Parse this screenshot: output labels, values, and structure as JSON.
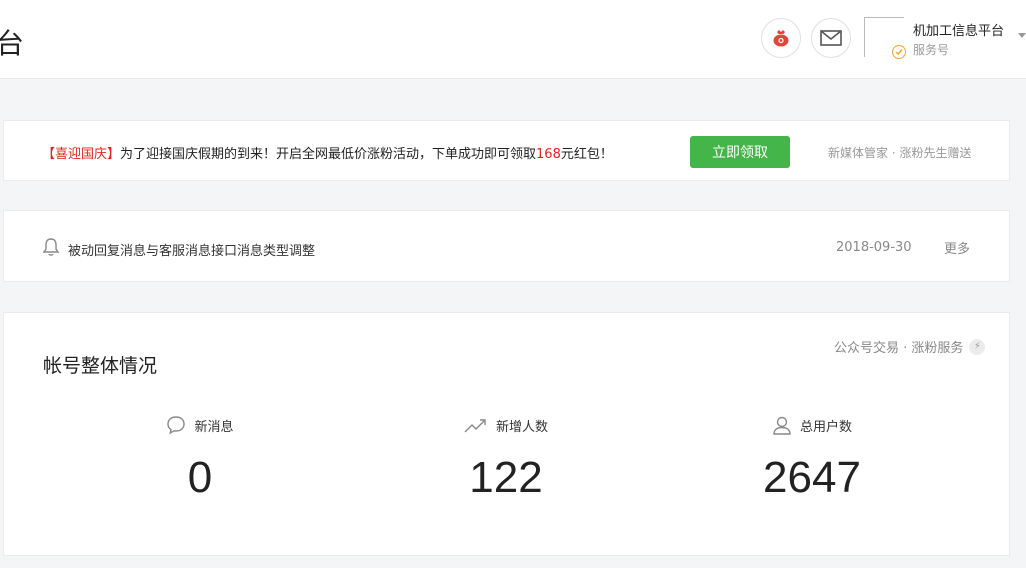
{
  "header": {
    "page_title": "台",
    "account_name": "机加工信息平台",
    "account_type": "服务号",
    "colors": {
      "bag": "#e2453a",
      "verified": "#f3a52c"
    },
    "icons": [
      "money-bag-icon",
      "mail-icon",
      "verified-badge-icon",
      "chevron-down-icon"
    ]
  },
  "promo": {
    "tag": "【喜迎国庆】",
    "text_before": "为了迎接国庆假期的到来！开启全网最低价涨粉活动，下单成功即可领取",
    "amount": "168",
    "text_after": "元红包！",
    "button_label": "立即领取",
    "source": "新媒体管家 · 涨粉先生赠送",
    "colors": {
      "tag": "#e1251b",
      "button": "#44b549"
    }
  },
  "notice": {
    "title": "被动回复消息与客服消息接口消息类型调整",
    "date": "2018-09-30",
    "more_label": "更多",
    "icon": "bell-icon"
  },
  "overview": {
    "title": "帐号整体情况",
    "link_label": "公众号交易 · 涨粉服务",
    "stats": [
      {
        "label": "新消息",
        "value": "0",
        "icon": "chat-bubble-icon"
      },
      {
        "label": "新增人数",
        "value": "122",
        "icon": "trend-up-icon"
      },
      {
        "label": "总用户数",
        "value": "2647",
        "icon": "user-icon"
      }
    ]
  }
}
